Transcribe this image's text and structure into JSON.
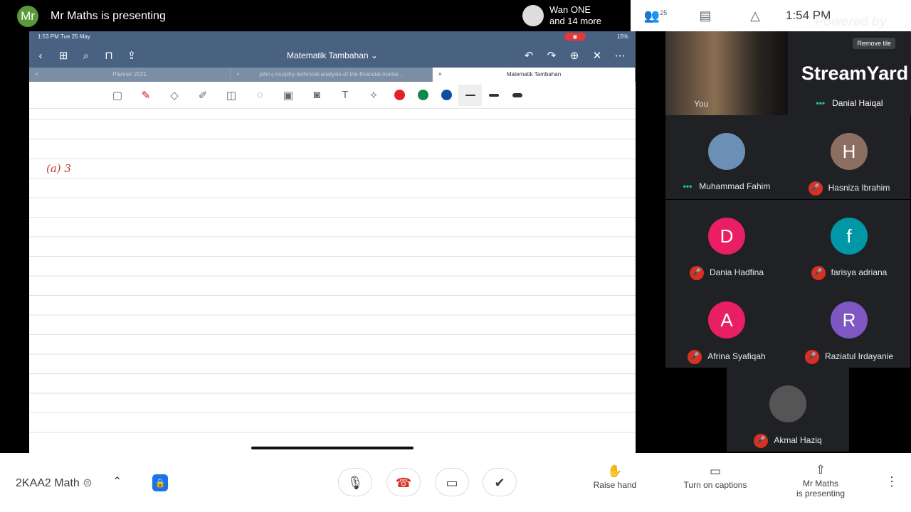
{
  "topbar": {
    "presenter_initials": "Mr",
    "presenting_text": "Mr Maths is presenting",
    "others_name": "Wan ONE",
    "others_more": "and 14 more",
    "participant_count": "25",
    "time": "1:54 PM"
  },
  "ipad": {
    "status_time": "1:53 PM   Tue 25 May",
    "battery": "15%",
    "doc_title": "Matematik Tambahan ⌄",
    "tabs": [
      {
        "label": "Planner 2021"
      },
      {
        "label": "john-j-murphy-technical-analysis-of-the-financial-marke..."
      },
      {
        "label": "Matematik Tambahan"
      }
    ],
    "colors": {
      "red": "#e0232b",
      "green": "#0c8a4e",
      "blue": "#0b4fa0"
    },
    "handwriting": "(a) 3"
  },
  "panel": {
    "self_label": "You",
    "brand": "StreamYard",
    "powered_by": "Powered by",
    "remove_tile": "Remove tile",
    "featured_name": "Danial Haiqal",
    "participants": [
      {
        "name": "Muhammad Fahim",
        "initial": "",
        "color": "#6b8fb5",
        "muted": false
      },
      {
        "name": "Hasniza Ibrahim",
        "initial": "H",
        "color": "#8d6e63",
        "muted": true
      },
      {
        "name": "Dania Hadfina",
        "initial": "D",
        "color": "#e91e63",
        "muted": true
      },
      {
        "name": "farisya adriana",
        "initial": "f",
        "color": "#0097a7",
        "muted": true
      },
      {
        "name": "Afrina Syafiqah",
        "initial": "A",
        "color": "#e91e63",
        "muted": true
      },
      {
        "name": "Raziatul Irdayanie",
        "initial": "R",
        "color": "#7e57c2",
        "muted": true
      },
      {
        "name": "Akmal Haziq",
        "initial": "",
        "color": "#555",
        "muted": true
      }
    ]
  },
  "bottom": {
    "meeting_name": "2KAA2 Math",
    "raise_hand": "Raise hand",
    "captions": "Turn on captions",
    "presenting_1": "Mr Maths",
    "presenting_2": "is presenting"
  }
}
